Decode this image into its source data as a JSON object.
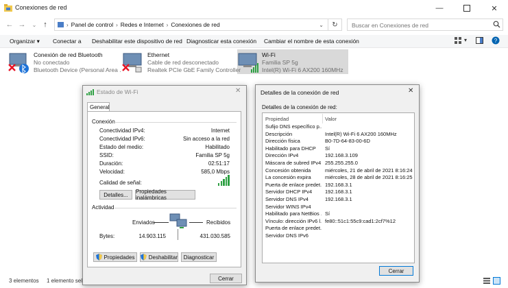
{
  "window": {
    "title": "Conexiones de red",
    "icons": {
      "app": "network-folder-icon",
      "minimize": "minimize-icon",
      "maximize": "maximize-icon",
      "close": "close-icon"
    }
  },
  "address": {
    "crumbs": [
      "Panel de control",
      "Redes e Internet",
      "Conexiones de red"
    ],
    "search_placeholder": "Buscar en Conexiones de red"
  },
  "toolbar": {
    "organize": "Organizar ▾",
    "connect_to": "Conectar a",
    "disable": "Deshabilitar este dispositivo de red",
    "diagnose": "Diagnosticar esta conexión",
    "rename": "Cambiar el nombre de esta conexión"
  },
  "connections": [
    {
      "name": "Conexión de red Bluetooth",
      "status": "No conectado",
      "device": "Bluetooth Device (Personal Area ..."
    },
    {
      "name": "Ethernet",
      "status": "Cable de red desconectado",
      "device": "Realtek PCIe GbE Family Controller"
    },
    {
      "name": "Wi-Fi",
      "status": "Familia SP 5g",
      "device": "Intel(R) Wi-Fi 6 AX200 160MHz"
    }
  ],
  "statusbar": {
    "count": "3 elementos",
    "selected": "1 elemento sele"
  },
  "wifi_status": {
    "title": "Estado de Wi-Fi",
    "tab": "General",
    "section_connection": "Conexión",
    "rows": [
      {
        "label": "Conectividad IPv4:",
        "value": "Internet"
      },
      {
        "label": "Conectividad IPv6:",
        "value": "Sin acceso a la red"
      },
      {
        "label": "Estado del medio:",
        "value": "Habilitado"
      },
      {
        "label": "SSID:",
        "value": "Familia SP 5g"
      },
      {
        "label": "Duración:",
        "value": "02:51:17"
      },
      {
        "label": "Velocidad:",
        "value": "585,0 Mbps"
      }
    ],
    "signal_label": "Calidad de señal:",
    "signal_bars": 5,
    "signal_bars_total": 5,
    "btn_details": "Detalles...",
    "btn_wireless": "Propiedades inalámbricas",
    "section_activity": "Actividad",
    "sent_label": "Enviados",
    "received_label": "Recibidos",
    "bytes_label": "Bytes:",
    "bytes_sent": "14.903.115",
    "bytes_received": "431.030.585",
    "btn_properties": "Propiedades",
    "btn_disable": "Deshabilitar",
    "btn_diagnose": "Diagnosticar",
    "btn_close": "Cerrar"
  },
  "details": {
    "title": "Detalles de la conexión de red",
    "caption": "Detalles de la conexión de red:",
    "col_property": "Propiedad",
    "col_value": "Valor",
    "rows": [
      {
        "p": "Sufijo DNS específico p...",
        "v": ""
      },
      {
        "p": "Descripción",
        "v": "Intel(R) Wi-Fi 6 AX200 160MHz"
      },
      {
        "p": "Dirección física",
        "v": "B0-7D-64-83-00-6D"
      },
      {
        "p": "Habilitado para DHCP",
        "v": "Sí"
      },
      {
        "p": "Dirección IPv4",
        "v": "192.168.3.109"
      },
      {
        "p": "Máscara de subred IPv4",
        "v": "255.255.255.0"
      },
      {
        "p": "Concesión obtenida",
        "v": "miércoles, 21 de abril de 2021 8:16:24"
      },
      {
        "p": "La concesión expira",
        "v": "miércoles, 28 de abril de 2021 8:16:25"
      },
      {
        "p": "Puerta de enlace predet...",
        "v": "192.168.3.1"
      },
      {
        "p": "Servidor DHCP IPv4",
        "v": "192.168.3.1"
      },
      {
        "p": "Servidor DNS IPv4",
        "v": "192.168.3.1"
      },
      {
        "p": "Servidor WINS IPv4",
        "v": ""
      },
      {
        "p": "Habilitado para NetBios ...",
        "v": "Sí"
      },
      {
        "p": "Vínculo: dirección IPv6 l...",
        "v": "fe80::51c1:55c9:cad1:2cf7%12"
      },
      {
        "p": "Puerta de enlace predet...",
        "v": ""
      },
      {
        "p": "Servidor DNS IPv6",
        "v": ""
      }
    ],
    "btn_close": "Cerrar"
  },
  "colors": {
    "accent": "#0078d7",
    "signal_green": "#2ea043",
    "disabled_x": "#e81123",
    "selection": "#d9d9d9"
  }
}
